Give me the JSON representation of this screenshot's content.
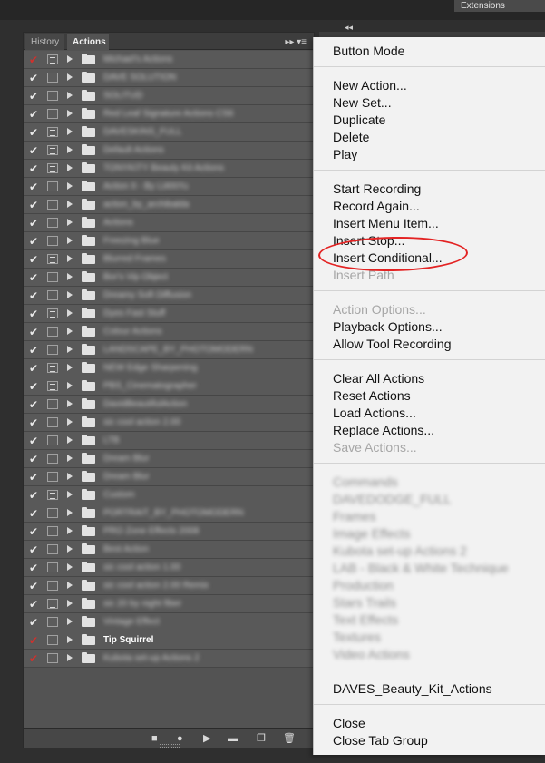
{
  "app": {
    "extensions_label": "Extensions",
    "dock_arrows": "◂◂"
  },
  "panel": {
    "tabs": [
      {
        "label": "History"
      },
      {
        "label": "Actions"
      }
    ],
    "tab_tools": "▸▸ ▾≡"
  },
  "actions": [
    {
      "check": "red",
      "dialog": true,
      "name": "Michael's Actions",
      "blur": true
    },
    {
      "check": "white",
      "dialog": false,
      "name": "DAVE SOLUTION",
      "blur": true
    },
    {
      "check": "white",
      "dialog": false,
      "name": "SOLITUD",
      "blur": true
    },
    {
      "check": "white",
      "dialog": false,
      "name": "Red Leaf Signature Actions CS6",
      "blur": true
    },
    {
      "check": "white",
      "dialog": true,
      "name": "DAVESKINS_FULL",
      "blur": true
    },
    {
      "check": "white",
      "dialog": true,
      "name": "Default Actions",
      "blur": true
    },
    {
      "check": "white",
      "dialog": true,
      "name": "TONYKITY Beauty Kit Actions",
      "blur": true
    },
    {
      "check": "white",
      "dialog": false,
      "name": "Action It - By LIANYu",
      "blur": true
    },
    {
      "check": "white",
      "dialog": false,
      "name": "action_by_archibalda",
      "blur": true
    },
    {
      "check": "white",
      "dialog": false,
      "name": "Actions",
      "blur": true
    },
    {
      "check": "white",
      "dialog": false,
      "name": "Freezing Blue",
      "blur": true
    },
    {
      "check": "white",
      "dialog": true,
      "name": "Blurred Frames",
      "blur": true
    },
    {
      "check": "white",
      "dialog": false,
      "name": "Bor's Vip Object",
      "blur": true
    },
    {
      "check": "white",
      "dialog": false,
      "name": "Dreamy Soft Diffusion",
      "blur": true
    },
    {
      "check": "white",
      "dialog": true,
      "name": "Dyes Fast Stuff",
      "blur": true
    },
    {
      "check": "white",
      "dialog": false,
      "name": "Colour Actions",
      "blur": true
    },
    {
      "check": "white",
      "dialog": false,
      "name": "LANDSCAPE_BY_PHOTOMODERN",
      "blur": true
    },
    {
      "check": "white",
      "dialog": true,
      "name": "NEW Edge Sharpening",
      "blur": true
    },
    {
      "check": "white",
      "dialog": true,
      "name": "PBS_Cinematographer",
      "blur": true
    },
    {
      "check": "white",
      "dialog": false,
      "name": "DavidBeautifulAction",
      "blur": true
    },
    {
      "check": "white",
      "dialog": false,
      "name": "sic cool action 2.00",
      "blur": true
    },
    {
      "check": "white",
      "dialog": false,
      "name": "LTB",
      "blur": true
    },
    {
      "check": "white",
      "dialog": false,
      "name": "Dream Blur",
      "blur": true
    },
    {
      "check": "white",
      "dialog": false,
      "name": "Dream Blur",
      "blur": true
    },
    {
      "check": "white",
      "dialog": true,
      "name": "Custom",
      "blur": true
    },
    {
      "check": "white",
      "dialog": false,
      "name": "PORTRAIT_BY_PHOTOMODERN",
      "blur": true
    },
    {
      "check": "white",
      "dialog": false,
      "name": "PRO Zone Effects 2008",
      "blur": true
    },
    {
      "check": "white",
      "dialog": false,
      "name": "Best Action",
      "blur": true
    },
    {
      "check": "white",
      "dialog": false,
      "name": "sic cool action 1.00",
      "blur": true
    },
    {
      "check": "white",
      "dialog": false,
      "name": "sic cool action 2.00 Remix",
      "blur": true
    },
    {
      "check": "white",
      "dialog": true,
      "name": "sic 20 by night fiber",
      "blur": true
    },
    {
      "check": "white",
      "dialog": false,
      "name": "Vintage Effect",
      "blur": true
    },
    {
      "check": "red",
      "dialog": false,
      "name": "Tip Squirrel",
      "blur": false
    },
    {
      "check": "red",
      "dialog": false,
      "name": "Kubota set-up Actions 2",
      "blur": true
    }
  ],
  "panel_footer": {
    "icons": [
      "stop-icon",
      "record-icon",
      "play-icon",
      "new-set-icon",
      "new-action-icon",
      "trash-icon"
    ]
  },
  "menu": {
    "button_mode": "Button Mode",
    "new_action": "New Action...",
    "new_set": "New Set...",
    "duplicate": "Duplicate",
    "delete": "Delete",
    "play": "Play",
    "start_recording": "Start Recording",
    "record_again": "Record Again...",
    "insert_menu_item": "Insert Menu Item...",
    "insert_stop": "Insert Stop...",
    "insert_conditional": "Insert Conditional...",
    "insert_path": "Insert Path",
    "action_options": "Action Options...",
    "playback_options": "Playback Options...",
    "allow_tool_recording": "Allow Tool Recording",
    "clear_all_actions": "Clear All Actions",
    "reset_actions": "Reset Actions",
    "load_actions": "Load Actions...",
    "replace_actions": "Replace Actions...",
    "save_actions": "Save Actions...",
    "set_list": [
      "Commands",
      "DAVEDODGE_FULL",
      "Frames",
      "Image Effects",
      "Kubota set-up Actions 2",
      "LAB - Black & White Technique",
      "Production",
      "Stars Trails",
      "Text Effects",
      "Textures",
      "Video Actions"
    ],
    "daves_kit": "DAVES_Beauty_Kit_Actions",
    "close": "Close",
    "close_tab_group": "Close Tab Group"
  },
  "colors": {
    "highlight_oval": "#e32323",
    "check_red": "#d0312d"
  }
}
